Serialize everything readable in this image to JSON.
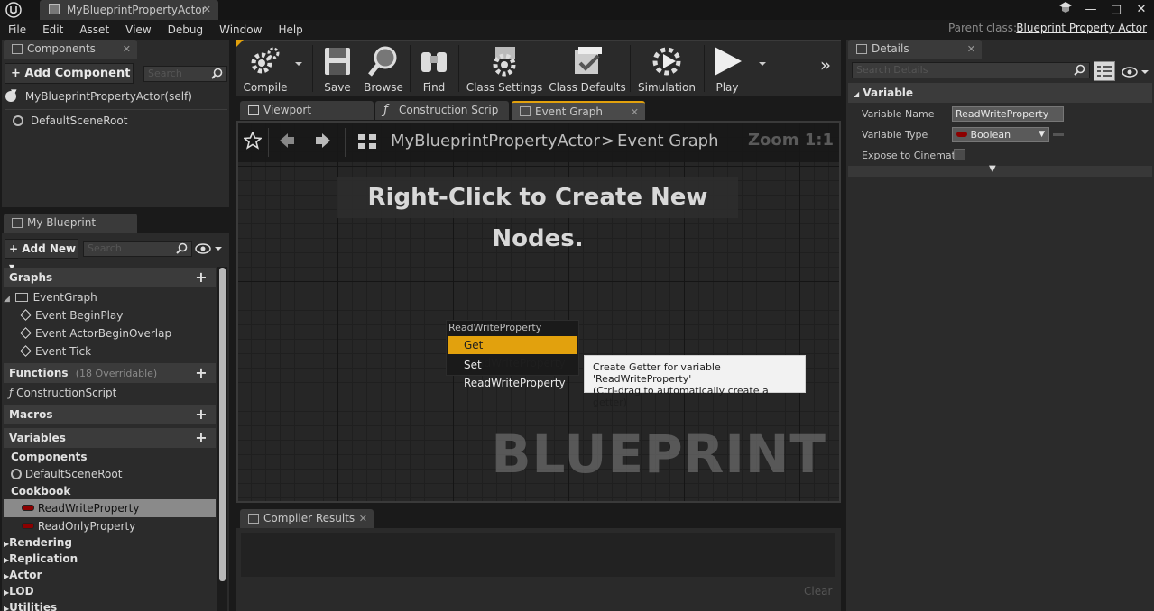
{
  "window": {
    "tab_title": "MyBlueprintPropertyActor",
    "minimize": "—",
    "restore": "□",
    "close": "✕"
  },
  "menu": [
    "File",
    "Edit",
    "Asset",
    "View",
    "Debug",
    "Window",
    "Help"
  ],
  "parent_class": {
    "label": "Parent class:",
    "value": "Blueprint Property Actor"
  },
  "components_panel": {
    "tab": "Components",
    "add_component": "+ Add Component ▾",
    "search_placeholder": "Search",
    "items": [
      "MyBlueprintPropertyActor(self)",
      "DefaultSceneRoot"
    ]
  },
  "my_blueprint": {
    "tab": "My Blueprint",
    "add_new": "+ Add New ▾",
    "search_placeholder": "Search",
    "graphs": {
      "label": "Graphs",
      "items": [
        "EventGraph",
        "Event BeginPlay",
        "Event ActorBeginOverlap",
        "Event Tick"
      ]
    },
    "functions": {
      "label": "Functions",
      "sub": "(18 Overridable)",
      "items": [
        "ConstructionScript"
      ]
    },
    "macros": {
      "label": "Macros"
    },
    "variables": {
      "label": "Variables",
      "components_label": "Components",
      "components_items": [
        "DefaultSceneRoot"
      ],
      "cookbook_label": "Cookbook",
      "cookbook_items": [
        "ReadWriteProperty",
        "ReadOnlyProperty"
      ],
      "more": [
        "Rendering",
        "Replication",
        "Actor",
        "LOD",
        "Utilities"
      ]
    }
  },
  "toolbar": {
    "compile": "Compile",
    "save": "Save",
    "browse": "Browse",
    "find": "Find",
    "class_settings": "Class Settings",
    "class_defaults": "Class Defaults",
    "simulation": "Simulation",
    "play": "Play",
    "overflow": "»"
  },
  "editor_tabs": [
    "Viewport",
    "Construction Scrip",
    "Event Graph"
  ],
  "graph": {
    "breadcrumb_root": "MyBlueprintPropertyActor",
    "breadcrumb_sep": ">",
    "breadcrumb_current": "Event Graph",
    "zoom": "Zoom 1:1",
    "hint": "Right-Click to Create New Nodes.",
    "watermark": "BLUEPRINT"
  },
  "context_menu": {
    "header": "ReadWriteProperty",
    "items": [
      "Get ReadWriteProperty",
      "Set ReadWriteProperty"
    ]
  },
  "tooltip": {
    "line1": "Create Getter for variable 'ReadWriteProperty'",
    "line2": "(Ctrl-drag to automatically create a getter)"
  },
  "compiler_results": {
    "tab": "Compiler Results",
    "clear": "Clear"
  },
  "details": {
    "tab": "Details",
    "search_placeholder": "Search Details",
    "category": "Variable",
    "name_label": "Variable Name",
    "name_value": "ReadWriteProperty",
    "type_label": "Variable Type",
    "type_value": "Boolean",
    "expose_label": "Expose to Cinemat"
  },
  "colors": {
    "accent": "#e2a10d",
    "background": "#1a1a1a",
    "panel": "#2b2b2b",
    "boolean_pin": "#8c0000"
  }
}
